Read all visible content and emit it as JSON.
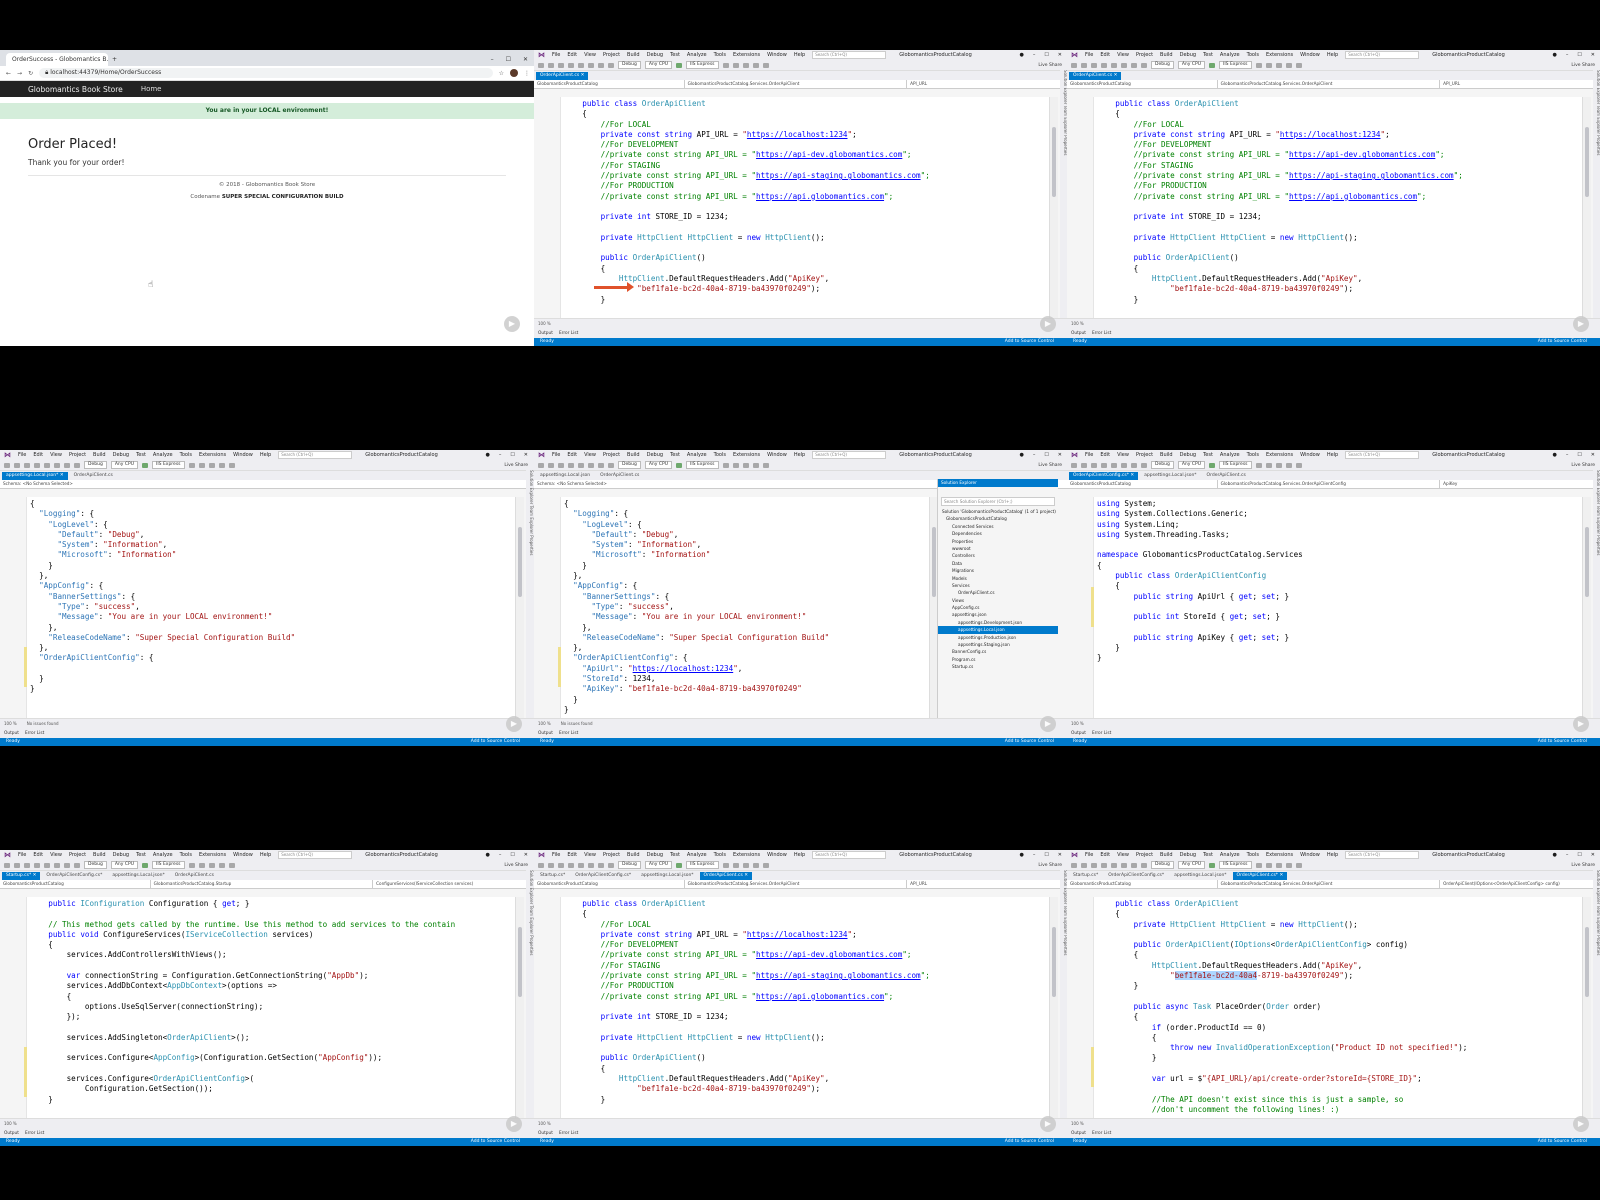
{
  "browser": {
    "tab_title": "OrderSuccess - Globomantics B...",
    "new_tab": "+",
    "address": "localhost:44379/Home/OrderSuccess",
    "brand": "Globomantics Book Store",
    "nav_home": "Home",
    "alert": "You are in your LOCAL environment!",
    "heading": "Order Placed!",
    "message": "Thank you for your order!",
    "copyright": "© 2018 - Globomantics Book Store",
    "codename_label": "Codename",
    "codename_value": "SUPER SPECIAL CONFIGURATION BUILD"
  },
  "vs": {
    "menu": [
      "File",
      "Edit",
      "View",
      "Project",
      "Build",
      "Debug",
      "Test",
      "Analyze",
      "Tools",
      "Extensions",
      "Window",
      "Help"
    ],
    "search_placeholder": "Search (Ctrl+Q)",
    "solution_name": "GlobomanticsProductCatalog",
    "config": "Debug",
    "platform": "Any CPU",
    "run_target": "IIS Express",
    "live_share": "Live Share",
    "status_ready": "Ready",
    "add_to_source": "Add to Source Control",
    "output_tab": "Output",
    "error_list_tab": "Error List",
    "no_issues": "No issues found",
    "zoom": "100 %",
    "side_labels": "Solution Explorer   Team Explorer   Properties"
  },
  "tiles": [
    {
      "tabs": [
        {
          "label": "OrderApiClient.cs",
          "active": true
        }
      ],
      "nav": [
        "GlobomanticsProductCatalog",
        "GlobomanticsProductCatalog.Services.OrderApiClient",
        "API_URL"
      ]
    },
    {
      "tabs": [
        {
          "label": "OrderApiClient.cs",
          "active": true
        }
      ],
      "nav": [
        "GlobomanticsProductCatalog",
        "GlobomanticsProductCatalog.Services.OrderApiClient",
        "API_URL"
      ]
    },
    {
      "tabs": [
        {
          "label": "appsettings.Local.json*",
          "active": true
        },
        {
          "label": "OrderApiClient.cs",
          "active": false
        }
      ],
      "nav": [
        "Schema: <No Schema Selected>"
      ]
    },
    {
      "tabs": [
        {
          "label": "appsettings.Local.json",
          "active": false
        },
        {
          "label": "OrderApiClient.cs",
          "active": false
        }
      ],
      "nav": [
        "Schema: <No Schema Selected>"
      ]
    },
    {
      "tabs": [
        {
          "label": "OrderApiClientConfig.cs*",
          "active": true
        },
        {
          "label": "appsettings.Local.json*",
          "active": false
        },
        {
          "label": "OrderApiClient.cs",
          "active": false
        }
      ],
      "nav": [
        "GlobomanticsProductCatalog",
        "GlobomanticsProductCatalog.Services.OrderApiClientConfig",
        "ApiKey"
      ]
    },
    {
      "tabs": [
        {
          "label": "Startup.cs*",
          "active": true
        },
        {
          "label": "OrderApiClientConfig.cs*",
          "active": false
        },
        {
          "label": "appsettings.Local.json*",
          "active": false
        },
        {
          "label": "OrderApiClient.cs",
          "active": false
        }
      ],
      "nav": [
        "GlobomanticsProductCatalog",
        "GlobomanticsProductCatalog.Startup",
        "ConfigureServices(IServiceCollection services)"
      ]
    },
    {
      "tabs": [
        {
          "label": "Startup.cs*",
          "active": false
        },
        {
          "label": "OrderApiClientConfig.cs*",
          "active": false
        },
        {
          "label": "appsettings.Local.json*",
          "active": false
        },
        {
          "label": "OrderApiClient.cs",
          "active": true
        }
      ],
      "nav": [
        "GlobomanticsProductCatalog",
        "GlobomanticsProductCatalog.Services.OrderApiClient",
        "API_URL"
      ]
    },
    {
      "tabs": [
        {
          "label": "Startup.cs*",
          "active": false
        },
        {
          "label": "OrderApiClientConfig.cs*",
          "active": false
        },
        {
          "label": "appsettings.Local.json*",
          "active": false
        },
        {
          "label": "OrderApiClient.cs*",
          "active": true
        }
      ],
      "nav": [
        "GlobomanticsProductCatalog",
        "GlobomanticsProductCatalog.Services.OrderApiClient",
        "OrderApiClient(IOptions<OrderApiClientConfig> config)"
      ]
    }
  ],
  "code": {
    "client_v1": [
      "    public class OrderApiClient",
      "    {",
      "        //For LOCAL",
      "        private const string API_URL = \"https://localhost:1234\";",
      "        //For DEVELOPMENT",
      "        //private const string API_URL = \"https://api-dev.globomantics.com\";",
      "        //For STAGING",
      "        //private const string API_URL = \"https://api-staging.globomantics.com\";",
      "        //For PRODUCTION",
      "        //private const string API_URL = \"https://api.globomantics.com\";",
      "",
      "        private int STORE_ID = 1234;",
      "",
      "        private HttpClient HttpClient = new HttpClient();",
      "",
      "        public OrderApiClient()",
      "        {",
      "            HttpClient.DefaultRequestHeaders.Add(\"ApiKey\",",
      "                \"bef1fa1e-bc2d-40a4-8719-ba43970f0249\");",
      "        }"
    ],
    "json_partial": [
      "{",
      "  \"Logging\": {",
      "    \"LogLevel\": {",
      "      \"Default\": \"Debug\",",
      "      \"System\": \"Information\",",
      "      \"Microsoft\": \"Information\"",
      "    }",
      "  },",
      "  \"AppConfig\": {",
      "    \"BannerSettings\": {",
      "      \"Type\": \"success\",",
      "      \"Message\": \"You are in your LOCAL environment!\"",
      "    },",
      "    \"ReleaseCodeName\": \"Super Special Configuration Build\"",
      "  },",
      "  \"OrderApiClientConfig\": {",
      "",
      "  }",
      "}"
    ],
    "json_full": [
      "{",
      "  \"Logging\": {",
      "    \"LogLevel\": {",
      "      \"Default\": \"Debug\",",
      "      \"System\": \"Information\",",
      "      \"Microsoft\": \"Information\"",
      "    }",
      "  },",
      "  \"AppConfig\": {",
      "    \"BannerSettings\": {",
      "      \"Type\": \"success\",",
      "      \"Message\": \"You are in your LOCAL environment!\"",
      "    },",
      "    \"ReleaseCodeName\": \"Super Special Configuration Build\"",
      "  },",
      "  \"OrderApiClientConfig\": {",
      "    \"ApiUrl\": \"https://localhost:1234\",",
      "    \"StoreId\": 1234,",
      "    \"ApiKey\": \"bef1fa1e-bc2d-40a4-8719-ba43970f0249\"",
      "  }",
      "}"
    ],
    "config_class": [
      "using System;",
      "using System.Collections.Generic;",
      "using System.Linq;",
      "using System.Threading.Tasks;",
      "",
      "namespace GlobomanticsProductCatalog.Services",
      "{",
      "    public class OrderApiClientConfig",
      "    {",
      "        public string ApiUrl { get; set; }",
      "",
      "        public int StoreId { get; set; }",
      "",
      "        public string ApiKey { get; set; }",
      "    }",
      "}"
    ],
    "startup": [
      "    public IConfiguration Configuration { get; }",
      "",
      "    // This method gets called by the runtime. Use this method to add services to the contain",
      "    public void ConfigureServices(IServiceCollection services)",
      "    {",
      "        services.AddControllersWithViews();",
      "",
      "        var connectionString = Configuration.GetConnectionString(\"AppDb\");",
      "        services.AddDbContext<AppDbContext>(options =>",
      "        {",
      "            options.UseSqlServer(connectionString);",
      "        });",
      "",
      "        services.AddSingleton<OrderApiClient>();",
      "",
      "        services.Configure<AppConfig>(Configuration.GetSection(\"AppConfig\"));",
      "",
      "        services.Configure<OrderApiClientConfig>(",
      "            Configuration.GetSection());",
      "    }"
    ],
    "client_v2": [
      "    public class OrderApiClient",
      "    {",
      "        private HttpClient HttpClient = new HttpClient();",
      "",
      "        public OrderApiClient(IOptions<OrderApiClientConfig> config)",
      "        {",
      "            HttpClient.DefaultRequestHeaders.Add(\"ApiKey\",",
      "                \"bef1fa1e-bc2d-40a4-8719-ba43970f0249\");",
      "        }",
      "",
      "        public async Task PlaceOrder(Order order)",
      "        {",
      "            if (order.ProductId == 0)",
      "            {",
      "                throw new InvalidOperationException(\"Product ID not specified!\");",
      "            }",
      "",
      "            var url = $\"{API_URL}/api/create-order?storeId={STORE_ID}\";",
      "",
      "            //The API doesn't exist since this is just a sample, so",
      "            //don't uncomment the following lines! :)"
    ]
  },
  "solution_explorer": {
    "title": "Solution Explorer",
    "search": "Search Solution Explorer (Ctrl+;)",
    "items": [
      "Solution 'GlobomanticsProductCatalog' (1 of 1 project)",
      "GlobomanticsProductCatalog",
      "Connected Services",
      "Dependencies",
      "Properties",
      "wwwroot",
      "Controllers",
      "Data",
      "Migrations",
      "Models",
      "Services",
      "OrderApiClient.cs",
      "Views",
      "AppConfig.cs",
      "appsettings.json",
      "appsettings.Development.json",
      "appsettings.Local.json",
      "appsettings.Production.json",
      "appsettings.Staging.json",
      "BannerConfig.cs",
      "Program.cs",
      "Startup.cs"
    ]
  }
}
